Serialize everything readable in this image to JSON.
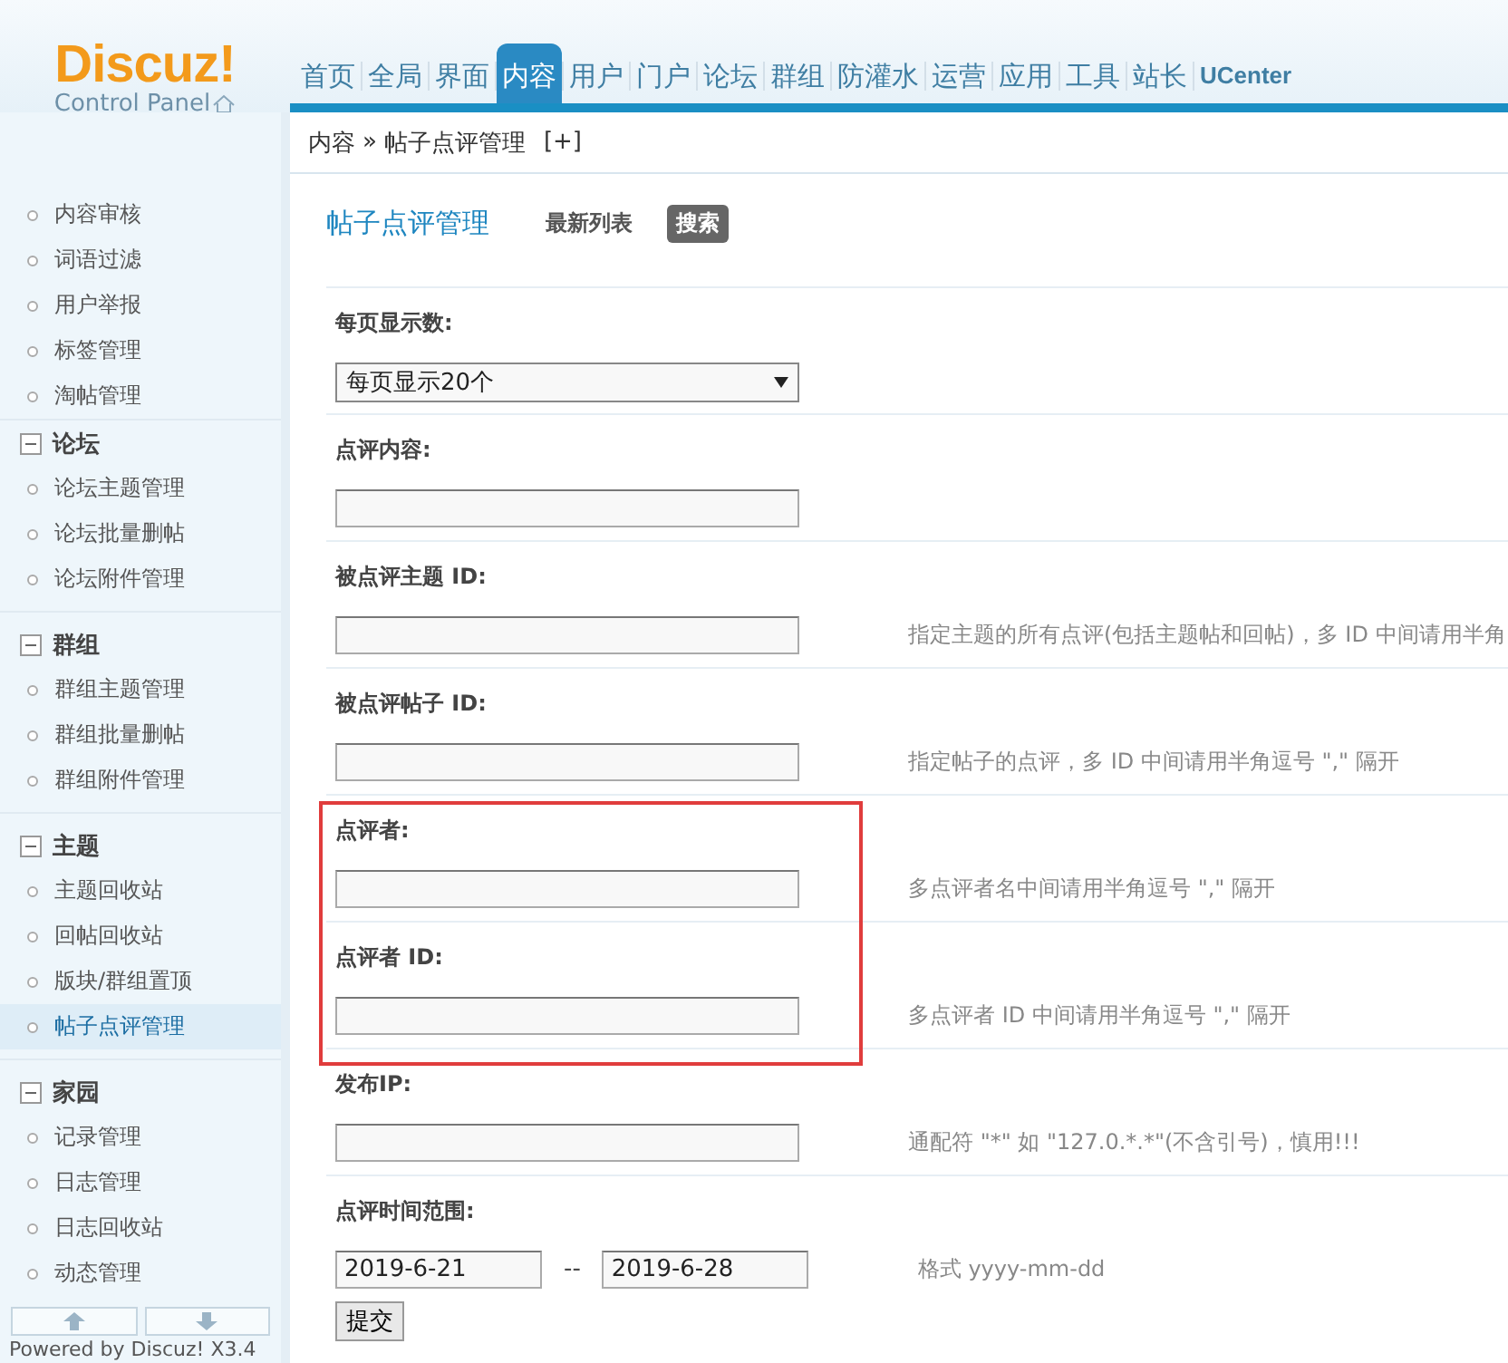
{
  "logo": {
    "name": "Discuz!",
    "subtitle": "Control Panel"
  },
  "nav": [
    {
      "label": "首页",
      "selected": false
    },
    {
      "label": "全局",
      "selected": false
    },
    {
      "label": "界面",
      "selected": false
    },
    {
      "label": "内容",
      "selected": true
    },
    {
      "label": "用户",
      "selected": false
    },
    {
      "label": "门户",
      "selected": false
    },
    {
      "label": "论坛",
      "selected": false
    },
    {
      "label": "群组",
      "selected": false
    },
    {
      "label": "防灌水",
      "selected": false
    },
    {
      "label": "运营",
      "selected": false
    },
    {
      "label": "应用",
      "selected": false
    },
    {
      "label": "工具",
      "selected": false
    },
    {
      "label": "站长",
      "selected": false
    },
    {
      "label": "UCenter",
      "selected": false
    }
  ],
  "breadcrumb": {
    "path": "内容",
    "separator": "»",
    "current": "帖子点评管理",
    "add": "[+]"
  },
  "sidebar": {
    "groups": [
      {
        "items": [
          {
            "label": "内容审核",
            "selected": false
          },
          {
            "label": "词语过滤",
            "selected": false
          },
          {
            "label": "用户举报",
            "selected": false
          },
          {
            "label": "标签管理",
            "selected": false
          },
          {
            "label": "淘帖管理",
            "selected": false
          }
        ]
      },
      {
        "title": "论坛",
        "expanded": true,
        "items": [
          {
            "label": "论坛主题管理",
            "selected": false
          },
          {
            "label": "论坛批量删帖",
            "selected": false
          },
          {
            "label": "论坛附件管理",
            "selected": false
          }
        ]
      },
      {
        "title": "群组",
        "expanded": true,
        "items": [
          {
            "label": "群组主题管理",
            "selected": false
          },
          {
            "label": "群组批量删帖",
            "selected": false
          },
          {
            "label": "群组附件管理",
            "selected": false
          }
        ]
      },
      {
        "title": "主题",
        "expanded": true,
        "items": [
          {
            "label": "主题回收站",
            "selected": false
          },
          {
            "label": "回帖回收站",
            "selected": false
          },
          {
            "label": "版块/群组置顶",
            "selected": false
          },
          {
            "label": "帖子点评管理",
            "selected": true
          }
        ]
      },
      {
        "title": "家园",
        "expanded": true,
        "items": [
          {
            "label": "记录管理",
            "selected": false
          },
          {
            "label": "日志管理",
            "selected": false
          },
          {
            "label": "日志回收站",
            "selected": false
          },
          {
            "label": "动态管理",
            "selected": false
          }
        ]
      }
    ],
    "footer": "Powered by Discuz! X3.4"
  },
  "page": {
    "title": "帖子点评管理",
    "tabs": [
      {
        "label": "最新列表",
        "selected": false
      },
      {
        "label": "搜索",
        "selected": true
      }
    ]
  },
  "form": {
    "rows": [
      {
        "kind": "select",
        "label": "每页显示数:",
        "value": "每页显示20个",
        "highlighted": false
      },
      {
        "kind": "text",
        "label": "点评内容:",
        "highlighted": false
      },
      {
        "kind": "text",
        "label": "被点评主题 ID:",
        "hint": "指定主题的所有点评(包括主题帖和回帖)，多 ID 中间请用半角",
        "highlighted": false
      },
      {
        "kind": "text",
        "label": "被点评帖子 ID:",
        "hint": "指定帖子的点评，多 ID 中间请用半角逗号 \",\" 隔开",
        "highlighted": false
      },
      {
        "kind": "text",
        "label": "点评者:",
        "hint": "多点评者名中间请用半角逗号 \",\" 隔开",
        "highlighted": true
      },
      {
        "kind": "text",
        "label": "点评者 ID:",
        "hint": "多点评者 ID 中间请用半角逗号 \",\" 隔开",
        "highlighted": true
      },
      {
        "kind": "text",
        "label": "发布IP:",
        "hint": "通配符 \"*\" 如 \"127.0.*.*\"(不含引号)，慎用!!!",
        "highlighted": false
      },
      {
        "kind": "daterange",
        "label": "点评时间范围:",
        "from": "2019-6-21",
        "separator": "--",
        "to": "2019-6-28",
        "hint": "格式 yyyy-mm-dd",
        "highlighted": false
      }
    ],
    "submit": "提交"
  }
}
